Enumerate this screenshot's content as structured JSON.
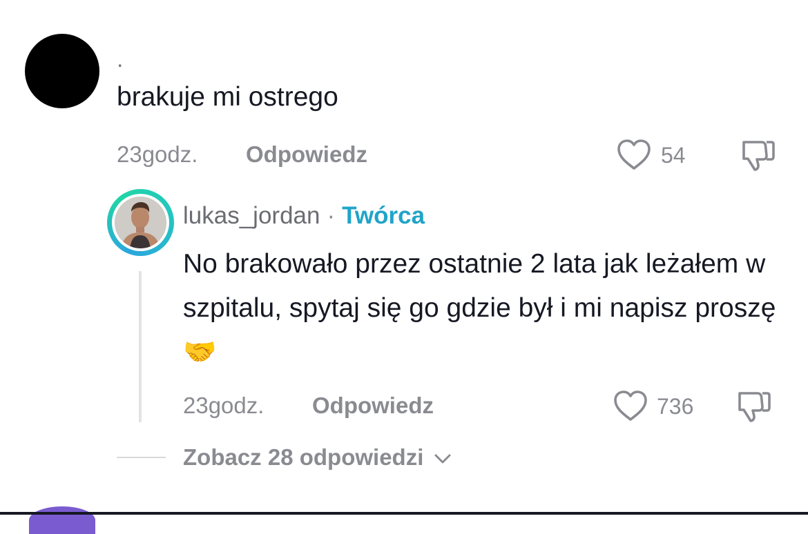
{
  "comment": {
    "username": ".",
    "text": "brakuje mi ostrego",
    "time": "23godz.",
    "reply_label": "Odpowiedz",
    "likes": "54"
  },
  "reply": {
    "username": "lukas_jordan",
    "separator": "·",
    "badge": "Twórca",
    "text": "No brakowało przez ostatnie 2 lata jak leżałem w szpitalu, spytaj się go gdzie był i mi napisz proszę 🤝",
    "time": "23godz.",
    "reply_label": "Odpowiedz",
    "likes": "736"
  },
  "see_replies": "Zobacz 28 odpowiedzi",
  "colors": {
    "muted": "#8a8b91",
    "creator_badge": "#20a4c8",
    "avatar_ring_start": "#2ba6de",
    "avatar_ring_end": "#20d5a6"
  },
  "icons": {
    "like": "heart-outline-icon",
    "dislike": "thumbs-down-icon",
    "expand": "chevron-down-icon"
  }
}
